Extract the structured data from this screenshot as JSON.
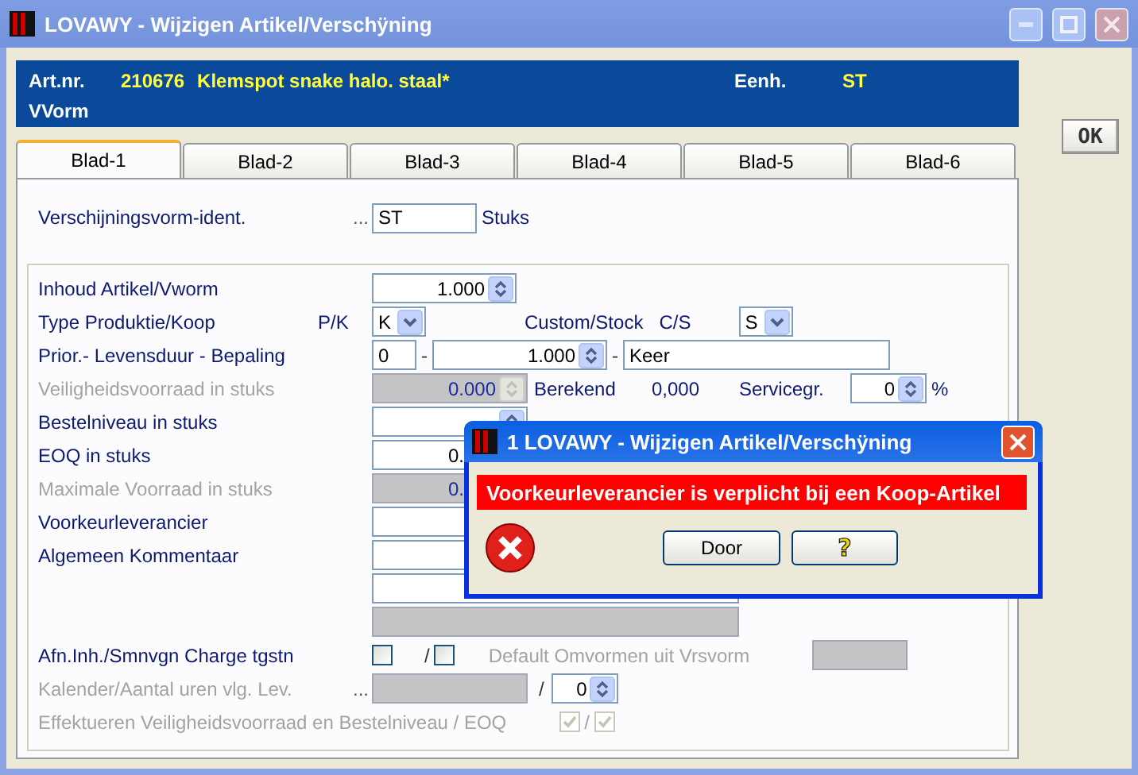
{
  "window": {
    "title": "LOVAWY - Wijzigen Artikel/Verschÿning",
    "active": false
  },
  "header": {
    "art_label": "Art.nr.",
    "art_number": "210676",
    "art_name": "Klemspot snake halo. staal*",
    "unit_label": "Eenh.",
    "unit": "ST",
    "form_label": "VVorm"
  },
  "tabs": [
    {
      "label": "Blad-1",
      "selected": true
    },
    {
      "label": "Blad-2",
      "selected": false
    },
    {
      "label": "Blad-3",
      "selected": false
    },
    {
      "label": "Blad-4",
      "selected": false
    },
    {
      "label": "Blad-5",
      "selected": false
    },
    {
      "label": "Blad-6",
      "selected": false
    }
  ],
  "ok_button": "OK",
  "ident": {
    "label": "Verschijningsvorm-ident.",
    "lookup": "...",
    "value": "ST",
    "unit": "Stuks"
  },
  "rows": [
    {
      "kind": "spin",
      "label": "Inhoud Artikel/Vworm",
      "disabled": false,
      "value": "1.000"
    },
    {
      "kind": "type",
      "label": "Type Produktie/Koop",
      "disabled": false,
      "pk_label": "P/K",
      "pk_value": "K",
      "cs_text": "Custom/Stock",
      "cs_label": "C/S",
      "cs_value": "S"
    },
    {
      "kind": "prior",
      "label": "Prior.- Levensduur - Bepaling",
      "disabled": false,
      "priority": "0",
      "separators": [
        "-",
        "-"
      ],
      "duration": "1.000",
      "unit": "Keer"
    },
    {
      "kind": "safety",
      "label": "Veiligheidsvoorraad in stuks",
      "disabled": true,
      "value": "0.000",
      "calc_label": "Berekend",
      "calc_value": "0,000",
      "service_label": "Servicegr.",
      "service_value": "0",
      "percent": "%"
    },
    {
      "kind": "spin",
      "label": "Bestelniveau in stuks",
      "disabled": false
    },
    {
      "kind": "field",
      "label": "EOQ in stuks",
      "disabled": false,
      "value": "0."
    },
    {
      "kind": "field",
      "label": "Maximale Voorraad in stuks",
      "disabled": true,
      "value": "0."
    },
    {
      "kind": "text",
      "label": "Voorkeurleverancier",
      "disabled": false
    },
    {
      "kind": "text",
      "label": "Algemeen Kommentaar",
      "disabled": false
    },
    {
      "kind": "text",
      "disabled": false
    },
    {
      "kind": "text",
      "disabled": true
    },
    {
      "kind": "charge",
      "label": "Afn.Inh./Smnvgn Charge tgstn",
      "disabled": false,
      "checks": [
        {
          "checked": false
        },
        {
          "checked": false
        }
      ],
      "separator": "/",
      "default_label": "Default Omvormen uit Vrsvorm"
    },
    {
      "kind": "calendar",
      "label": "Kalender/Aantal uren vlg. Lev.",
      "disabled": true,
      "lookup": "...",
      "separator": "/",
      "hours": "0"
    },
    {
      "kind": "effect",
      "label": "Effektueren Veiligheidsvoorraad en Bestelniveau / EOQ",
      "disabled": true,
      "checks": [
        {
          "checked": true
        },
        {
          "checked": true
        }
      ],
      "separator": "/"
    }
  ],
  "dialog": {
    "title": "1 LOVAWY - Wijzigen Artikel/Verschÿning",
    "message": "Voorkeurleverancier is verplicht bij een Koop-Artikel",
    "buttons": [
      "Door",
      "?"
    ]
  }
}
